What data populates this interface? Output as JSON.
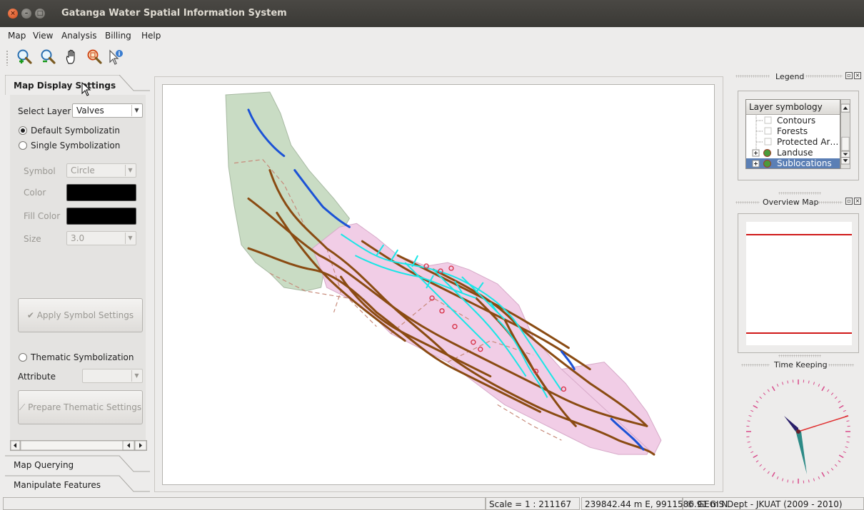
{
  "window": {
    "title": "Gatanga Water Spatial Information System"
  },
  "menu": [
    "Map",
    "View",
    "Analysis",
    "Billing",
    "Help"
  ],
  "toolbar": {
    "tools": [
      "zoom-in-icon",
      "zoom-out-icon",
      "pan-hand-icon",
      "zoom-full-icon",
      "identify-icon"
    ]
  },
  "left_panel": {
    "tab_display": "Map Display Settings",
    "select_layer_label": "Select Layer",
    "select_layer_value": "Valves",
    "default_symbolization": "Default Symbolizatin",
    "single_symbolization": "Single Symbolization",
    "symbol_label": "Symbol",
    "symbol_value": "Circle",
    "color_label": "Color",
    "fill_color_label": "Fill Color",
    "size_label": "Size",
    "size_value": "3.0",
    "apply_button": "Apply Symbol Settings",
    "thematic_symbolization": "Thematic Symbolization",
    "attribute_label": "Attribute",
    "attribute_value": "",
    "prepare_button": "Prepare Thematic Settings",
    "tab_querying": "Map Querying",
    "tab_manipulate": "Manipulate Features",
    "selected_symbolization": "Default Symbolizatin"
  },
  "legend": {
    "title": "Legend",
    "header": "Layer symbology",
    "items": [
      {
        "label": "Contours",
        "selected": false
      },
      {
        "label": "Forests",
        "selected": false
      },
      {
        "label": "Protected Ar…",
        "selected": false
      },
      {
        "label": "Landuse",
        "selected": false
      },
      {
        "label": "Sublocations",
        "selected": true
      }
    ]
  },
  "overview": {
    "title": "Overview Map"
  },
  "timekeeping": {
    "title": "Time Keeping"
  },
  "status": {
    "scale": "Scale = 1 : 211167",
    "coords": "239842.44 m E, 9911586.91 m N",
    "copyright": "© GEGIS Dept - JKUAT (2009 - 2010)"
  },
  "colors": {
    "title_bar": "#3f3e3a",
    "accent_selection": "#5b7fb5",
    "forest_green": "#c9dcc4",
    "sublocation_pink": "#f1cde6",
    "river_brown": "#8a4b12",
    "pipeline_cyan": "#19e6e6",
    "water_blue": "#1b52d6",
    "overview_extent_red": "#d01818"
  }
}
